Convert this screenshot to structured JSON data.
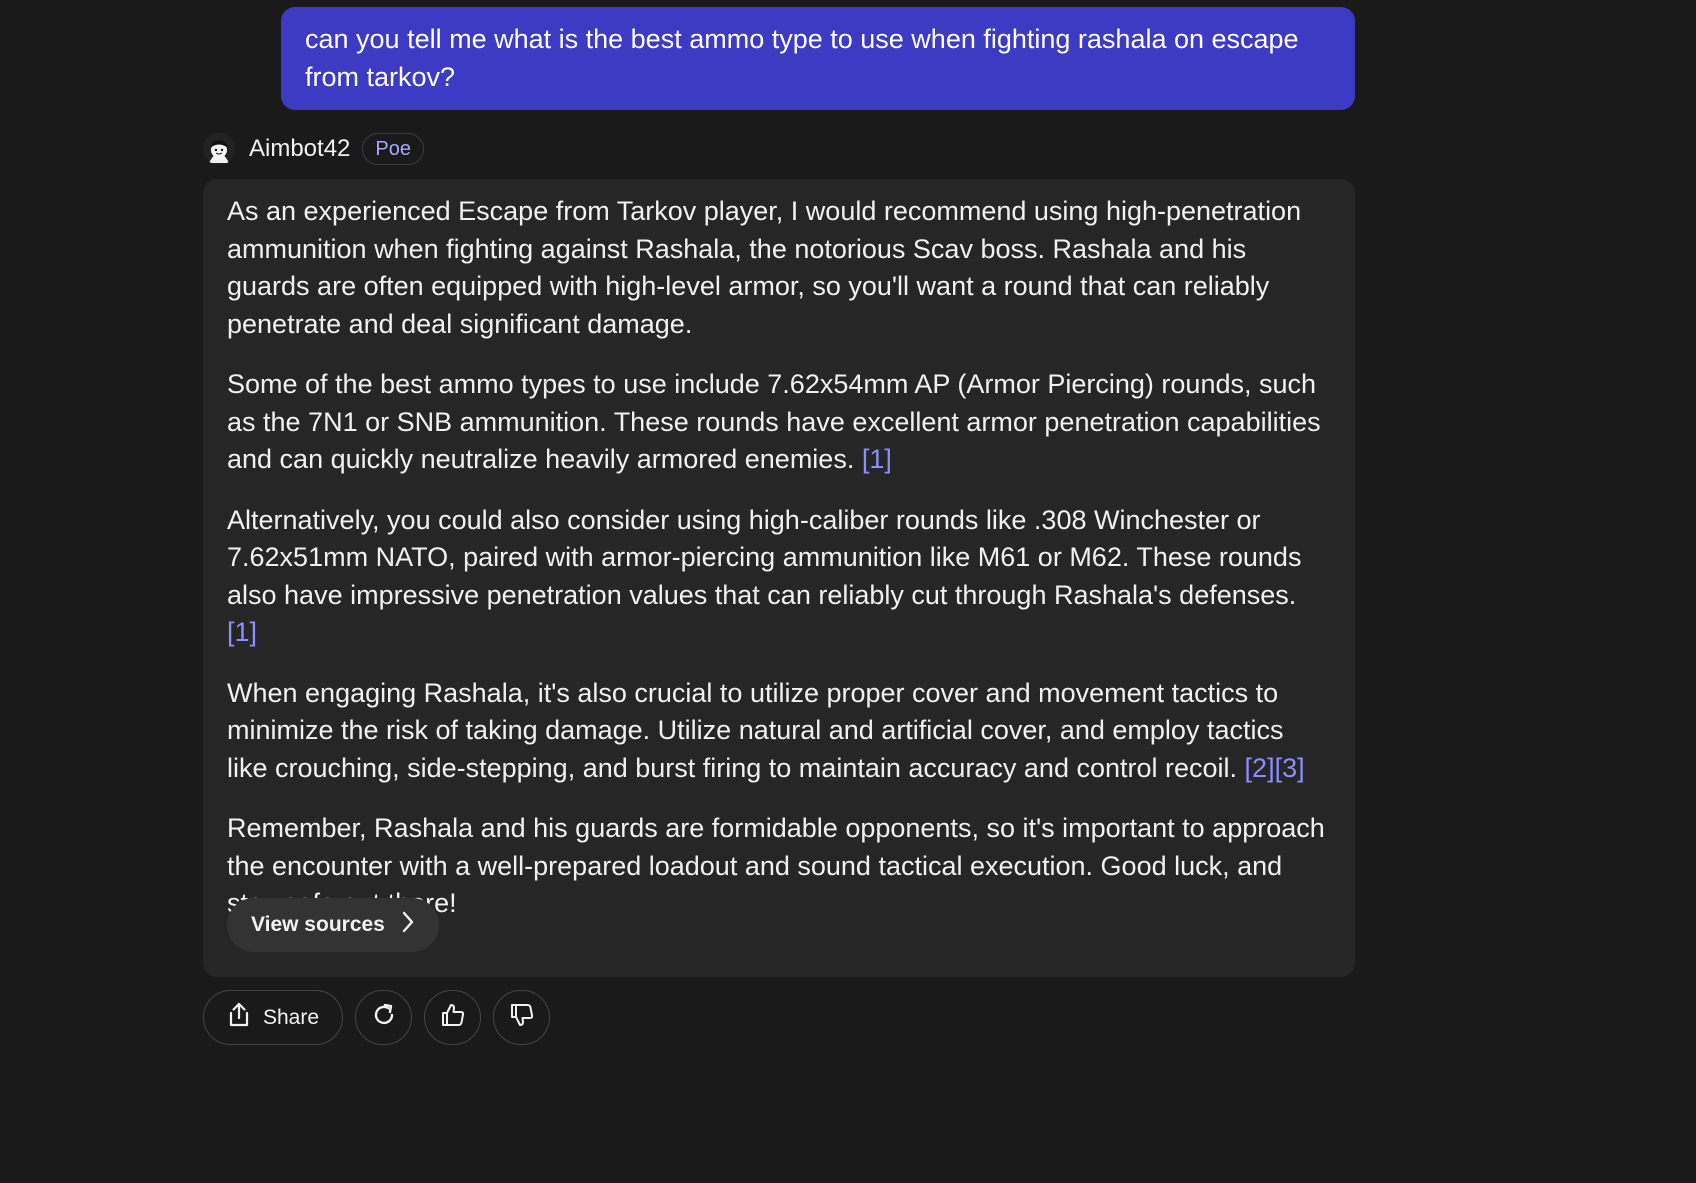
{
  "user_message": "can you tell me what is the best ammo type to use when fighting rashala on escape from tarkov?",
  "bot": {
    "name": "Aimbot42",
    "badge": "Poe",
    "avatar_icon": "avatar-icon"
  },
  "answer": {
    "paragraphs": [
      {
        "text": "As an experienced Escape from Tarkov player, I would recommend using high-penetration ammunition when fighting against Rashala, the notorious Scav boss. Rashala and his guards are often equipped with high-level armor, so you'll want a round that can reliably penetrate and deal significant damage.",
        "citation": ""
      },
      {
        "text": "Some of the best ammo types to use include 7.62x54mm AP (Armor Piercing) rounds, such as the 7N1 or SNB ammunition. These rounds have excellent armor penetration capabilities and can quickly neutralize heavily armored enemies.",
        "citation": "[1]"
      },
      {
        "text": "Alternatively, you could also consider using high-caliber rounds like .308 Winchester or 7.62x51mm NATO, paired with armor-piercing ammunition like M61 or M62. These rounds also have impressive penetration values that can reliably cut through Rashala's defenses.",
        "citation": "[1]"
      },
      {
        "text": "When engaging Rashala, it's also crucial to utilize proper cover and movement tactics to minimize the risk of taking damage. Utilize natural and artificial cover, and employ tactics like crouching, side-stepping, and burst firing to maintain accuracy and control recoil.",
        "citation": "[2][3]"
      },
      {
        "text": "Remember, Rashala and his guards are formidable opponents, so it's important to approach the encounter with a well-prepared loadout and sound tactical execution. Good luck, and stay safe out there!",
        "citation": ""
      }
    ],
    "view_sources_label": "View sources"
  },
  "actions": {
    "share_label": "Share",
    "icons": [
      "share-icon",
      "refresh-icon",
      "thumbs-up-icon",
      "thumbs-down-icon",
      "chevron-right-icon"
    ]
  },
  "colors": {
    "background": "#1a1a1a",
    "user_bubble": "#3d3bc4",
    "card": "#262626",
    "citation": "#8f8cff",
    "badge_text": "#a9a7ff"
  }
}
